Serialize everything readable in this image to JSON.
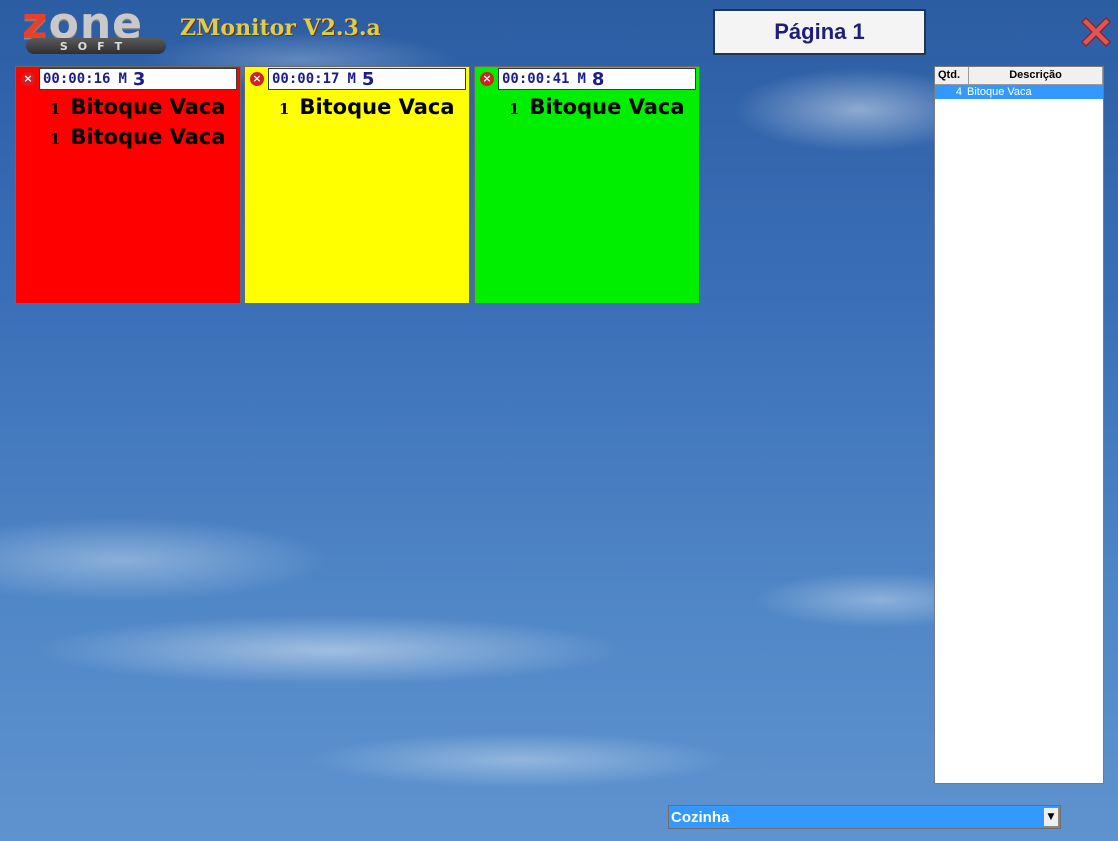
{
  "header": {
    "logo_word": "zone",
    "logo_sub": "SOFT",
    "app_title": "ZMonitor V2.3.a",
    "page_button": "Página 1"
  },
  "tickets": [
    {
      "time": "00:00:16",
      "m_label": "M",
      "mesa": "3",
      "color": "#ff0000",
      "items": [
        {
          "qty": "1",
          "desc": "Bitoque Vaca"
        },
        {
          "qty": "1",
          "desc": "Bitoque Vaca"
        }
      ]
    },
    {
      "time": "00:00:17",
      "m_label": "M",
      "mesa": "5",
      "color": "#ffff00",
      "items": [
        {
          "qty": "1",
          "desc": "Bitoque Vaca"
        }
      ]
    },
    {
      "time": "00:00:41",
      "m_label": "M",
      "mesa": "8",
      "color": "#00ee00",
      "items": [
        {
          "qty": "1",
          "desc": "Bitoque Vaca"
        }
      ]
    }
  ],
  "summary": {
    "columns": [
      "Qtd.",
      "Descrição"
    ],
    "rows": [
      {
        "qty": "4",
        "desc": "Bitoque Vaca"
      }
    ]
  },
  "station_select": {
    "value": "Cozinha"
  },
  "icons": {
    "close": "close-x-icon",
    "remove_ticket": "remove-circle-icon",
    "dropdown": "chevron-down-icon"
  }
}
